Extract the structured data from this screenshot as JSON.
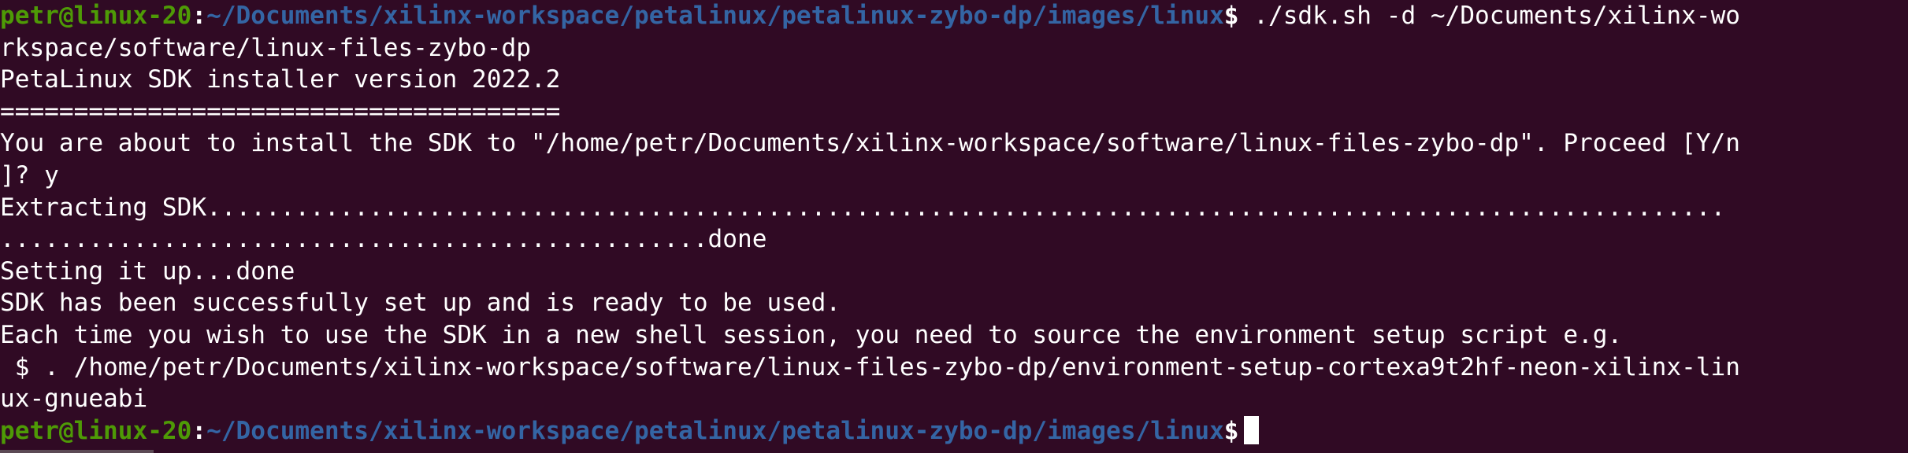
{
  "terminal": {
    "prompt1": {
      "user": "petr@linux-20",
      "sep": ":",
      "path": "~/Documents/xilinx-workspace/petalinux/petalinux-zybo-dp/images/linux",
      "dollar": "$",
      "command": " ./sdk.sh -d ~/Documents/xilinx-wo"
    },
    "output": [
      "rkspace/software/linux-files-zybo-dp",
      "PetaLinux SDK installer version 2022.2",
      "======================================",
      "You are about to install the SDK to \"/home/petr/Documents/xilinx-workspace/software/linux-files-zybo-dp\". Proceed [Y/n",
      "]? y",
      "Extracting SDK.......................................................................................................",
      "................................................done",
      "Setting it up...done",
      "SDK has been successfully set up and is ready to be used.",
      "Each time you wish to use the SDK in a new shell session, you need to source the environment setup script e.g.",
      " $ . /home/petr/Documents/xilinx-workspace/software/linux-files-zybo-dp/environment-setup-cortexa9t2hf-neon-xilinx-lin",
      "ux-gnueabi"
    ],
    "prompt2": {
      "user": "petr@linux-20",
      "sep": ":",
      "path": "~/Documents/xilinx-workspace/petalinux/petalinux-zybo-dp/images/linux",
      "dollar": "$",
      "command": " "
    },
    "colors": {
      "background": "#300a24",
      "user": "#4e9a06",
      "path": "#3465a4",
      "text": "#ffffff"
    }
  }
}
